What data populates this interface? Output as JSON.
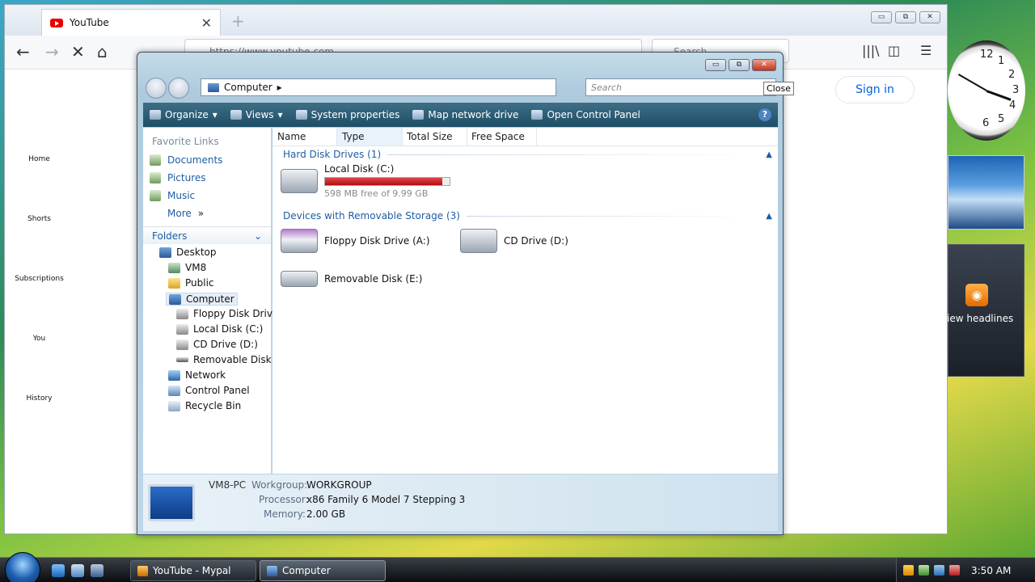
{
  "browser": {
    "tab_title": "YouTube",
    "tab_close": "✕",
    "new_tab": "+",
    "url": "https://www.youtube.com",
    "search_placeholder": "Search",
    "window_buttons": [
      "▭",
      "⧉",
      "✕"
    ],
    "nav": {
      "back": "←",
      "forward": "→",
      "stop": "✕",
      "home": "⌂"
    },
    "right_icons": {
      "library": "|||\\",
      "sidebar": "◫",
      "menu": "☰"
    }
  },
  "youtube": {
    "sidebar": [
      "Home",
      "Shorts",
      "Subscriptions",
      "You",
      "History"
    ],
    "sign_in": "Sign in"
  },
  "explorer": {
    "address": [
      "Computer",
      "▸"
    ],
    "search_placeholder": "Search",
    "tooltip": "Close",
    "toolbar": [
      "Organize",
      "Views",
      "System properties",
      "Map network drive",
      "Open Control Panel"
    ],
    "help": "?",
    "favorite_links_title": "Favorite Links",
    "favorite_links": [
      "Documents",
      "Pictures",
      "Music",
      "More"
    ],
    "more_arrow": "»",
    "folders_label": "Folders",
    "tree": [
      "Desktop",
      "VM8",
      "Public",
      "Computer",
      "Floppy Disk Drive",
      "Local Disk (C:)",
      "CD Drive (D:)",
      "Removable Disk (E:",
      "Network",
      "Control Panel",
      "Recycle Bin"
    ],
    "columns": [
      "Name",
      "Type",
      "Total Size",
      "Free Space"
    ],
    "groups": {
      "hard_disks": "Hard Disk Drives (1)",
      "removable": "Devices with Removable Storage (3)"
    },
    "local_disk": {
      "name": "Local Disk (C:)",
      "free": "598 MB free of 9.99 GB",
      "used_fraction": 0.94
    },
    "devices": [
      "Floppy Disk Drive (A:)",
      "CD Drive (D:)",
      "Removable Disk (E:)"
    ],
    "details": {
      "pc_name": "VM8-PC",
      "workgroup_label": "Workgroup:",
      "workgroup_value": "WORKGROUP",
      "processor_label": "Processor:",
      "processor_value": "x86 Family 6 Model 7 Stepping 3",
      "memory_label": "Memory:",
      "memory_value": "2.00 GB"
    }
  },
  "gadgets": {
    "clock_numbers": [
      "12",
      "1",
      "2",
      "3",
      "4",
      "5",
      "6"
    ],
    "feed_text": "iew headlines"
  },
  "taskbar": {
    "buttons": [
      "YouTube - Mypal",
      "Computer"
    ],
    "time": "3:50 AM"
  }
}
